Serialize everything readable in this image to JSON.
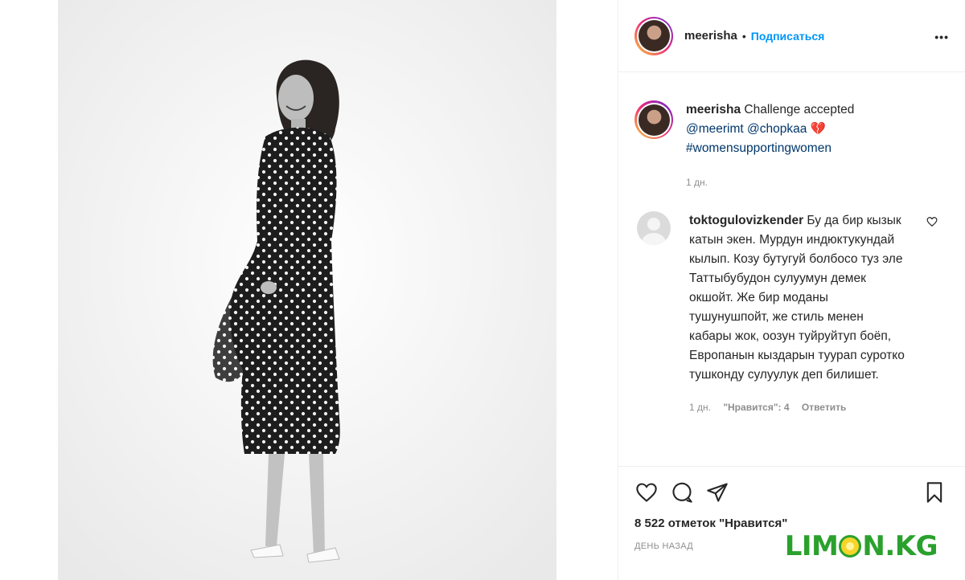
{
  "post": {
    "username": "meerisha",
    "separator": "•",
    "follow_label": "Подписаться",
    "more_label": "•••"
  },
  "caption": {
    "username": "meerisha",
    "text": " Challenge accepted ",
    "mention1": "@meerimt",
    "mention2": "@chopkaa",
    "emoji": "💔",
    "hashtag": "#womensupportingwomen",
    "time": "1 дн."
  },
  "comment": {
    "username": "toktogulovizkender",
    "text": " Бу да бир кызык катын экен. Мурдун индюктукундай кылып. Козу бутугуй болбосо туз эле Таттыбубудон сулуумун демек окшойт. Же бир моданы тушунушпойт, же стиль менен кабары жок, оозун туйруйтуп боёп, Европанын кыздарын туурап суротко тушконду сулуулук деп билишет.",
    "time": "1 дн.",
    "likes": "\"Нравится\": 4",
    "reply_label": "Ответить"
  },
  "actions": {
    "likes_text": "8 522 отметок \"Нравится\"",
    "timestamp": "ДЕНЬ НАЗАД"
  },
  "watermark": {
    "left": "LIM",
    "right": "N.KG"
  },
  "icons": {
    "like": "heart-icon",
    "comment": "comment-icon",
    "share": "paper-plane-icon",
    "save": "bookmark-icon",
    "more": "more-dots-icon"
  }
}
